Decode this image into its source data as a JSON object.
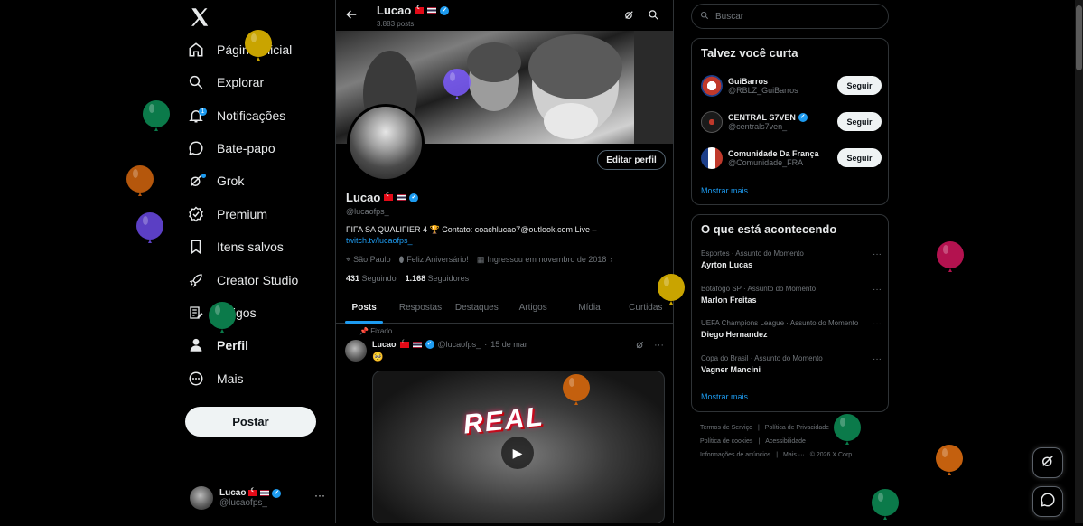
{
  "nav": {
    "items": [
      {
        "label": "Página Inicial",
        "icon": "home-icon"
      },
      {
        "label": "Explorar",
        "icon": "search-icon"
      },
      {
        "label": "Notificações",
        "icon": "bell-icon",
        "badge": "1"
      },
      {
        "label": "Bate-papo",
        "icon": "chat-icon"
      },
      {
        "label": "Grok",
        "icon": "grok-icon"
      },
      {
        "label": "Premium",
        "icon": "premium-icon"
      },
      {
        "label": "Itens salvos",
        "icon": "bookmark-icon"
      },
      {
        "label": "Creator Studio",
        "icon": "rocket-icon"
      },
      {
        "label": "Artigos",
        "icon": "article-icon"
      },
      {
        "label": "Perfil",
        "icon": "person-icon"
      },
      {
        "label": "Mais",
        "icon": "more-circle-icon"
      }
    ],
    "post_button": "Postar",
    "account": {
      "name": "Lucao",
      "handle": "@lucaofps_",
      "more": "···"
    }
  },
  "header": {
    "name": "Lucao",
    "posts_count": "3.883 posts"
  },
  "profile": {
    "name": "Lucao",
    "handle": "@lucaofps_",
    "edit_button": "Editar perfil",
    "bio": "FIFA SA QUALIFIER 4 🏆 Contato: coachlucao7@outlook.com Live –",
    "bio_link": "twitch.tv/lucaofps_",
    "location": "São Paulo",
    "birthday": "Feliz Aniversário!",
    "joined": "Ingressou em novembro de 2018",
    "following_count": "431",
    "following_label": "Seguindo",
    "followers_count": "1.168",
    "followers_label": "Seguidores"
  },
  "tabs": [
    "Posts",
    "Respostas",
    "Destaques",
    "Artigos",
    "Mídia",
    "Curtidas"
  ],
  "post": {
    "pinned_label": "Fixado",
    "author": "Lucao",
    "handle": "@lucaofps_",
    "separator": "·",
    "date": "15 de mar",
    "more": "···",
    "emoji": "🥺",
    "media_text": "REAL"
  },
  "search": {
    "placeholder": "Buscar"
  },
  "suggestions": {
    "title": "Talvez você curta",
    "items": [
      {
        "name": "GuiBarros",
        "handle": "@RBLZ_GuiBarros",
        "button": "Seguir",
        "color": "#c0392b"
      },
      {
        "name": "CENTRAL S7VEN",
        "handle": "@centrals7ven_",
        "button": "Seguir",
        "color": "#1a1a1a",
        "verified": true
      },
      {
        "name": "Comunidade Da França",
        "handle": "@Comunidade_FRA",
        "button": "Seguir",
        "color": "#1d3f8a"
      }
    ],
    "show_more": "Mostrar mais"
  },
  "trends": {
    "title": "O que está acontecendo",
    "items": [
      {
        "context": "Esportes · Assunto do Momento",
        "name": "Ayrton Lucas"
      },
      {
        "context": "Botafogo SP · Assunto do Momento",
        "name": "Marlon Freitas"
      },
      {
        "context": "UEFA Champions League · Assunto do Momento",
        "name": "Diego Hernandez"
      },
      {
        "context": "Copa do Brasil · Assunto do Momento",
        "name": "Vagner Mancini"
      }
    ],
    "more": "···",
    "show_more": "Mostrar mais"
  },
  "footer": {
    "links": [
      "Termos de Serviço",
      "|",
      "Política de Privacidade",
      "|",
      "Política de cookies",
      "|",
      "Acessibilidade",
      "|",
      "Informações de anúncios",
      "|",
      "Mais ···",
      "© 2026 X Corp."
    ]
  },
  "colors": {
    "accent": "#1d9bf0",
    "background": "#000000",
    "border": "#2f3336",
    "muted": "#71767b"
  }
}
